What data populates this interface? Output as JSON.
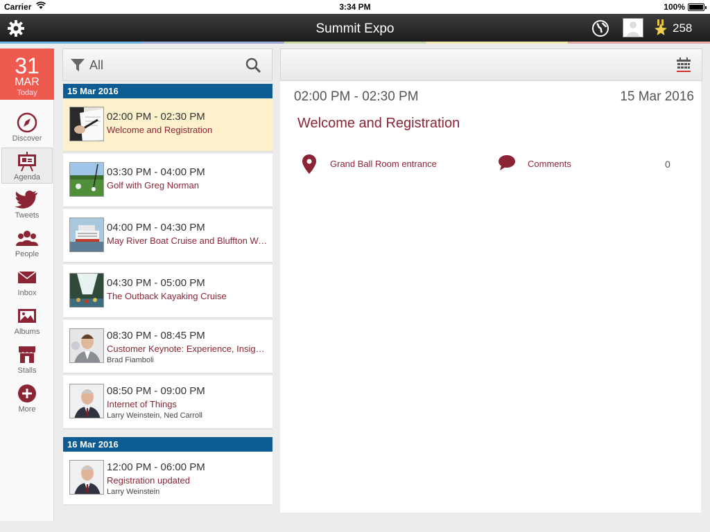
{
  "status_bar": {
    "carrier": "Carrier",
    "time": "3:34 PM",
    "battery": "100%"
  },
  "nav": {
    "title": "Summit Expo",
    "points": "258"
  },
  "today": {
    "day": "31",
    "month": "MAR",
    "label": "Today"
  },
  "sidebar": {
    "items": [
      {
        "label": "Discover",
        "icon": "compass-icon"
      },
      {
        "label": "Agenda",
        "icon": "presentation-icon"
      },
      {
        "label": "Tweets",
        "icon": "twitter-bird-icon"
      },
      {
        "label": "People",
        "icon": "people-icon"
      },
      {
        "label": "Inbox",
        "icon": "envelope-icon"
      },
      {
        "label": "Albums",
        "icon": "picture-icon"
      },
      {
        "label": "Stalls",
        "icon": "storefront-icon"
      },
      {
        "label": "More",
        "icon": "plus-circle-icon"
      }
    ]
  },
  "filter": {
    "label": "All"
  },
  "agenda": {
    "day1": "15 Mar 2016",
    "day2": "16 Mar 2016",
    "events": [
      {
        "time": "02:00 PM - 02:30 PM",
        "title": "Welcome and Registration"
      },
      {
        "time": "03:30 PM - 04:00 PM",
        "title": "Golf with Greg Norman"
      },
      {
        "time": "04:00 PM - 04:30 PM",
        "title": "May River Boat Cruise and Bluffton Walk"
      },
      {
        "time": "04:30 PM - 05:00 PM",
        "title": "The Outback Kayaking Cruise"
      },
      {
        "time": "08:30 PM - 08:45 PM",
        "title": "Customer Keynote: Experience, Insight and Action",
        "speakers": "Brad Fiamboli"
      },
      {
        "time": "08:50 PM - 09:00 PM",
        "title": "Internet of Things",
        "speakers": "Larry Weinstein, Ned Carroll"
      },
      {
        "time": "12:00 PM - 06:00 PM",
        "title": "Registration updated",
        "speakers": "Larry Weinstein"
      }
    ]
  },
  "detail": {
    "time": "02:00 PM - 02:30 PM",
    "date": "15 Mar 2016",
    "title": "Welcome and Registration",
    "location": "Grand Ball Room entrance",
    "comments_label": "Comments",
    "comments_count": "0"
  },
  "colors": {
    "accent": "#8b2434",
    "today_bg": "#ef5a4f",
    "day_header": "#0d5c93",
    "selected": "#fcf1cc"
  }
}
